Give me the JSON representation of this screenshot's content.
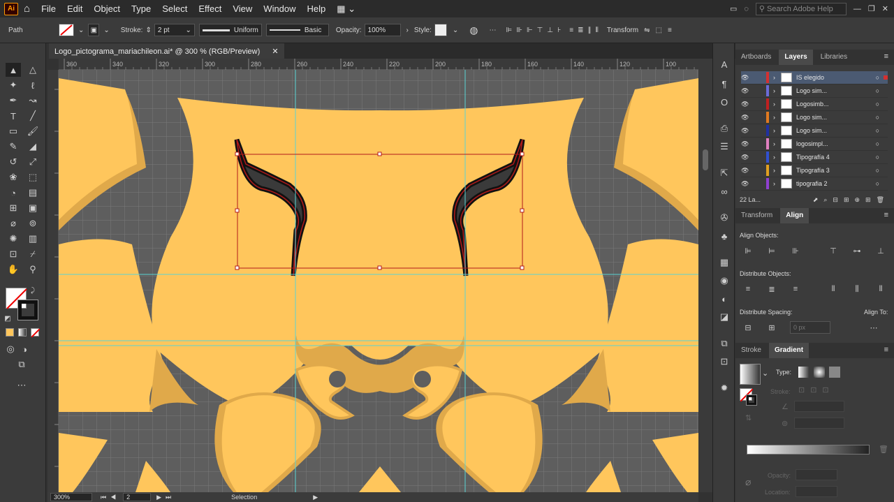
{
  "app": {
    "logo": "Ai"
  },
  "menu": [
    "File",
    "Edit",
    "Object",
    "Type",
    "Select",
    "Effect",
    "View",
    "Window",
    "Help"
  ],
  "search": {
    "placeholder": "Search Adobe Help"
  },
  "control": {
    "selection_type": "Path",
    "stroke_label": "Stroke:",
    "stroke_weight": "2 pt",
    "profile": "Uniform",
    "brush": "Basic",
    "opacity_label": "Opacity:",
    "opacity_value": "100%",
    "style_label": "Style:",
    "transform_label": "Transform"
  },
  "document": {
    "tab_title": "Logo_pictograma_mariachileon.ai* @ 300 % (RGB/Preview)",
    "close_icon": "close-icon"
  },
  "ruler": {
    "h_ticks": [
      "360",
      "340",
      "320",
      "300",
      "280",
      "260",
      "240",
      "220",
      "200",
      "180",
      "160",
      "140",
      "120",
      "100"
    ]
  },
  "status": {
    "zoom": "300%",
    "artboard": "2",
    "tool": "Selection"
  },
  "panels": {
    "top_tabs": [
      "Artboards",
      "Layers",
      "Libraries"
    ],
    "active_top_tab": "Layers",
    "layers": [
      {
        "name": "IS elegido",
        "color": "#d43030",
        "selected": true
      },
      {
        "name": "Logo sim...",
        "color": "#6b6bd8",
        "selected": false
      },
      {
        "name": "Logosimb...",
        "color": "#c02020",
        "selected": false
      },
      {
        "name": "Logo sim...",
        "color": "#e07a20",
        "selected": false
      },
      {
        "name": "Logo sim...",
        "color": "#2030a0",
        "selected": false
      },
      {
        "name": "logosimpl...",
        "color": "#e080c0",
        "selected": false
      },
      {
        "name": "Tipografía 4",
        "color": "#3050d0",
        "selected": false
      },
      {
        "name": "Tipografía 3",
        "color": "#e0a020",
        "selected": false
      },
      {
        "name": "tipografia 2",
        "color": "#9040d0",
        "selected": false
      }
    ],
    "layers_count": "22 La...",
    "mid_tabs": [
      "Transform",
      "Align"
    ],
    "align_objects": "Align Objects:",
    "distribute_objects": "Distribute Objects:",
    "distribute_spacing": "Distribute Spacing:",
    "align_to": "Align To:",
    "spacing_value": "0 px",
    "bottom_tabs": [
      "Stroke",
      "Gradient"
    ],
    "gradient_type": "Type:",
    "gradient_stroke": "Stroke:",
    "opacity": "Opacity:",
    "location": "Location:"
  },
  "colors": {
    "accent": "#ffc65c",
    "shadow": "#e0a94a",
    "canvas": "#5e5e5e",
    "guide": "#59d4d4",
    "selection": "#b11a1a"
  }
}
